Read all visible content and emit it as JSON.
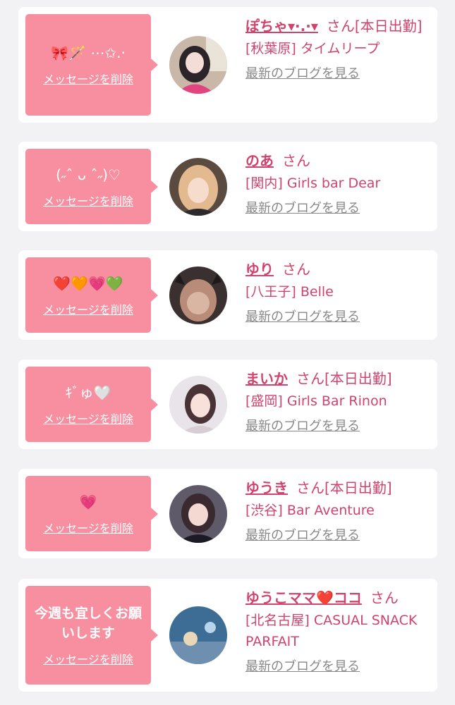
{
  "items": [
    {
      "message": "🎀🪄 ⋯✩.·",
      "delete_label": "メッセージを削除",
      "name": "ぽちゃ▾·.·▾",
      "honorific": "さん",
      "status": "[本日出勤]",
      "shop": "[秋葉原] タイムリープ",
      "blog_label": "最新のブログを見る"
    },
    {
      "message": "(˶ˆ ᴗ ˆ˶)♡",
      "delete_label": "メッセージを削除",
      "name": "のあ",
      "honorific": "さん",
      "status": "",
      "shop": "[関内] Girls bar Dear",
      "blog_label": "最新のブログを見る"
    },
    {
      "message": "❤️🧡💗💚",
      "delete_label": "メッセージを削除",
      "name": "ゆり",
      "honorific": "さん",
      "status": "",
      "shop": "[八王子] Belle",
      "blog_label": "最新のブログを見る"
    },
    {
      "message": "ｷﾞゅ🤍",
      "delete_label": "メッセージを削除",
      "name": "まいか",
      "honorific": "さん",
      "status": "[本日出勤]",
      "shop": "[盛岡] Girls Bar Rinon",
      "blog_label": "最新のブログを見る"
    },
    {
      "message": "💗",
      "delete_label": "メッセージを削除",
      "name": "ゆうき",
      "honorific": "さん",
      "status": "[本日出勤]",
      "shop": "[渋谷] Bar Aventure",
      "blog_label": "最新のブログを見る"
    },
    {
      "message": "今週も宜しくお願いします",
      "delete_label": "メッセージを削除",
      "name": "ゆうこママ❤️ココ",
      "honorific": "さん",
      "status": "",
      "shop": "[北名古屋] CASUAL SNACK PARFAIT",
      "blog_label": "最新のブログを見る"
    }
  ]
}
